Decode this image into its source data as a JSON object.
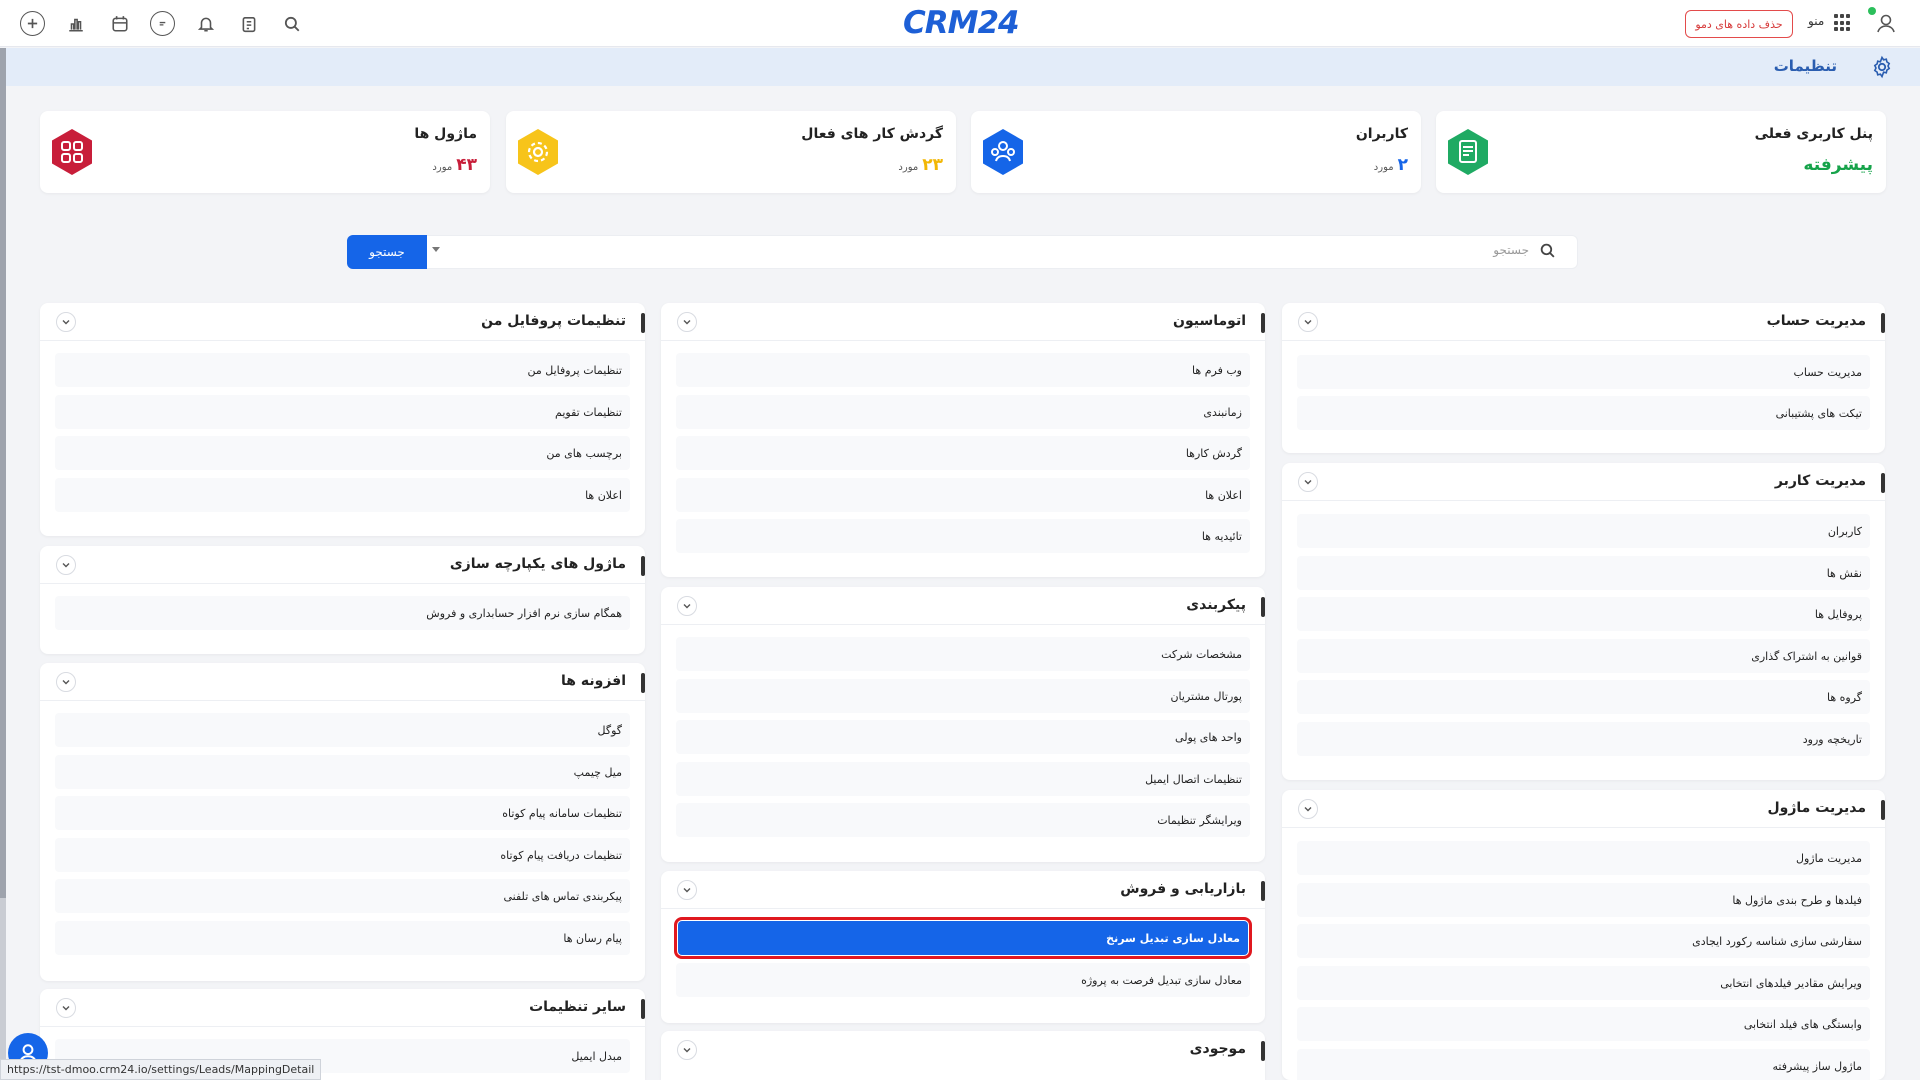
{
  "topbar": {
    "logo_prefix": "CRM",
    "logo_number": "24",
    "demo_button": "حذف داده های دمو",
    "menu_label": "منو"
  },
  "breadcrumb": {
    "title": "تنظیمات"
  },
  "stats": [
    {
      "title": "پنل کاربری فعلی",
      "value": "پیشرفته",
      "color": "#16a34a"
    },
    {
      "title": "کاربران",
      "value": "۲",
      "unit": "مورد",
      "color": "#1565e8"
    },
    {
      "title": "گردش کار های فعال",
      "value": "۲۳",
      "unit": "مورد",
      "color": "#f2b705"
    },
    {
      "title": "ماژول ها",
      "value": "۴۳",
      "unit": "مورد",
      "color": "#c81e3a"
    }
  ],
  "search": {
    "placeholder": "جستجو",
    "button": "جستجو"
  },
  "panels": {
    "account": {
      "title": "مدیریت حساب",
      "items": [
        "مدیریت حساب",
        "تیکت های پشتیبانی"
      ]
    },
    "users": {
      "title": "مدیریت کاربر",
      "items": [
        "کاربران",
        "نقش ها",
        "پروفایل ها",
        "قوانین به اشتراک گذاری",
        "گروه ها",
        "تاریخچه ورود"
      ]
    },
    "modules": {
      "title": "مدیریت ماژول",
      "items": [
        "مدیریت ماژول",
        "فیلدها و طرح بندی ماژول ها",
        "سفارشی سازی شناسه رکورد ایجادی",
        "ویرایش مقادیر فیلدهای انتخابی",
        "وابستگی های فیلد انتخابی",
        "ماژول ساز پیشرفته"
      ]
    },
    "automation": {
      "title": "اتوماسیون",
      "items": [
        "وب فرم ها",
        "زمانبندی",
        "گردش کارها",
        "اعلان ها",
        "تائیدیه ها"
      ]
    },
    "config": {
      "title": "پیکربندی",
      "items": [
        "مشخصات شرکت",
        "پورتال مشتریان",
        "واحد های پولی",
        "تنظیمات اتصال ایمیل",
        "ویرایشگر تنظیمات"
      ]
    },
    "marketing": {
      "title": "بازاریابی و فروش",
      "items": [
        "معادل سازی تبدیل سرنخ",
        "معادل سازی تبدیل فرصت به پروژه"
      ]
    },
    "inventory": {
      "title": "موجودی"
    },
    "profile": {
      "title": "تنظیمات پروفایل من",
      "items": [
        "تنظیمات پروفایل من",
        "تنظیمات تقویم",
        "برچسب های من",
        "اعلان ها"
      ]
    },
    "integration": {
      "title": "ماژول های یکپارچه سازی",
      "items": [
        "همگام سازی نرم افزار حسابداری و فروش"
      ]
    },
    "addons": {
      "title": "افزونه ها",
      "items": [
        "گوگل",
        "میل چیمپ",
        "تنظیمات سامانه پیام کوتاه",
        "تنظیمات دریافت پیام کوتاه",
        "پیکربندی تماس های تلفنی",
        "پیام رسان ها"
      ]
    },
    "other": {
      "title": "سایر تنظیمات",
      "items": [
        "مبدل ایمیل"
      ]
    }
  },
  "status_url": "https://tst-dmoo.crm24.io/settings/Leads/MappingDetail"
}
